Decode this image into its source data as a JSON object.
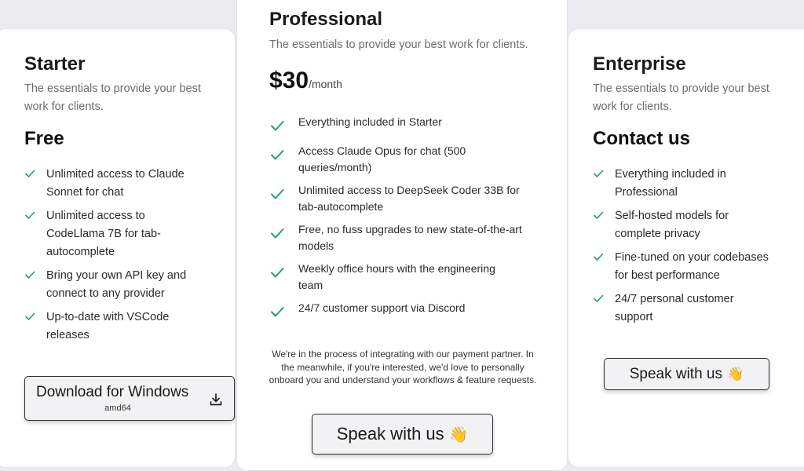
{
  "colors": {
    "check": "#22a06b",
    "background": "#ececf0",
    "card": "#ffffff"
  },
  "starter": {
    "title": "Starter",
    "description": "The essentials to provide your best work for clients.",
    "price": "Free",
    "features": [
      "Unlimited access to Claude Sonnet for chat",
      "Unlimited access to CodeLlama 7B for tab-autocomplete",
      "Bring your own API key and connect to any provider",
      "Up-to-date with VSCode releases"
    ],
    "button_label": "Download for Windows",
    "button_sub": "amd64",
    "button_icon": "download-icon"
  },
  "professional": {
    "title": "Professional",
    "description": "The essentials to provide your best work for clients.",
    "price": "$30",
    "price_unit": "/month",
    "features": [
      "Everything included in Starter",
      "Access Claude Opus for chat (500 queries/month)",
      "Unlimited access to DeepSeek Coder 33B for tab-autocomplete",
      "Free, no fuss upgrades to new state-of-the-art models",
      "Weekly office hours with the engineering team",
      "24/7 customer support via Discord"
    ],
    "note": "We're in the process of integrating with our payment partner. In the meanwhile, if you're interested, we'd love to personally onboard you and understand your workflows & feature requests.",
    "button_label": "Speak with us",
    "button_emoji": "👋"
  },
  "enterprise": {
    "title": "Enterprise",
    "description": "The essentials to provide your best work for clients.",
    "price": "Contact us",
    "features": [
      "Everything included in Professional",
      "Self-hosted models for complete privacy",
      "Fine-tuned on your codebases for best performance",
      "24/7 personal customer support"
    ],
    "button_label": "Speak with us",
    "button_emoji": "👋"
  }
}
